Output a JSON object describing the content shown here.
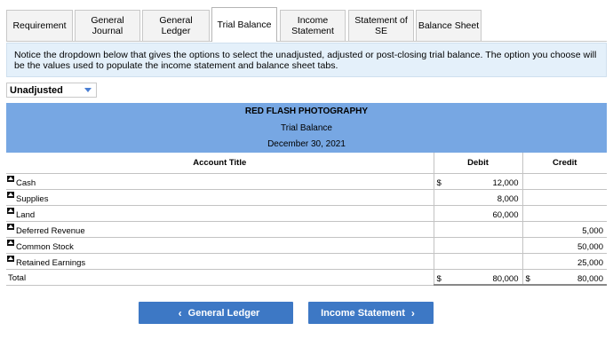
{
  "tabs": [
    {
      "label": "Requirement",
      "active": false
    },
    {
      "label": "General\nJournal",
      "active": false
    },
    {
      "label": "General\nLedger",
      "active": false
    },
    {
      "label": "Trial Balance",
      "active": true
    },
    {
      "label": "Income\nStatement",
      "active": false
    },
    {
      "label": "Statement of\nSE",
      "active": false
    },
    {
      "label": "Balance Sheet",
      "active": false
    }
  ],
  "notice": "Notice the dropdown below that gives the options to select the unadjusted, adjusted or post-closing trial balance. The option you choose will be the values used to populate the income statement and balance sheet tabs.",
  "dropdown": {
    "selected": "Unadjusted",
    "icon": "chevron-down-icon"
  },
  "report": {
    "company": "RED FLASH PHOTOGRAPHY",
    "title": "Trial Balance",
    "date": "December 30, 2021",
    "columns": {
      "account": "Account Title",
      "debit": "Debit",
      "credit": "Credit"
    },
    "rows": [
      {
        "account": "Cash",
        "debit_sign": "$",
        "debit": "12,000",
        "credit": ""
      },
      {
        "account": "Supplies",
        "debit_sign": "",
        "debit": "8,000",
        "credit": ""
      },
      {
        "account": "Land",
        "debit_sign": "",
        "debit": "60,000",
        "credit": ""
      },
      {
        "account": "Deferred Revenue",
        "debit_sign": "",
        "debit": "",
        "credit": "5,000"
      },
      {
        "account": "Common Stock",
        "debit_sign": "",
        "debit": "",
        "credit": "50,000"
      },
      {
        "account": "Retained Earnings",
        "debit_sign": "",
        "debit": "",
        "credit": "25,000"
      }
    ],
    "total": {
      "label": "Total",
      "debit_sign": "$",
      "debit": "80,000",
      "credit_sign": "$",
      "credit": "80,000"
    }
  },
  "nav": {
    "prev_label": "General Ledger",
    "next_label": "Income Statement",
    "prev_icon": "chevron-left-icon",
    "next_icon": "chevron-right-icon"
  },
  "colors": {
    "header_bg": "#77a7e3",
    "button_bg": "#3d78c5",
    "notice_bg": "#e4f0fa"
  }
}
